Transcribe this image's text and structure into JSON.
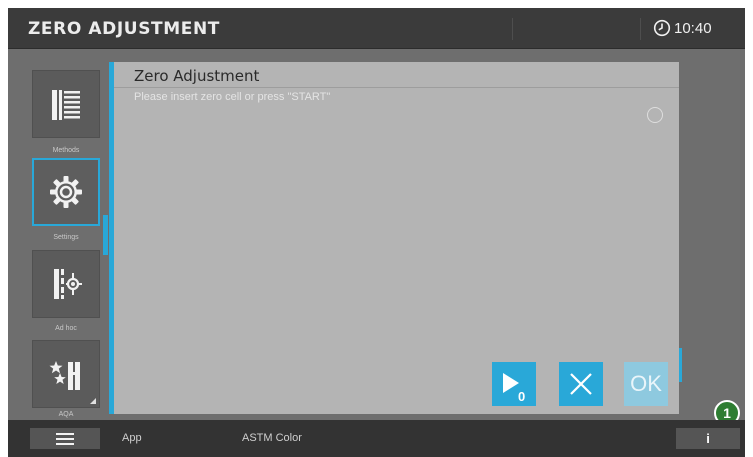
{
  "header": {
    "title": "ZERO ADJUSTMENT",
    "time": "10:40"
  },
  "sidebar": {
    "items": [
      {
        "label": "Methods",
        "icon": "methods-icon"
      },
      {
        "label": "Settings",
        "icon": "gear-icon"
      },
      {
        "label": "Ad hoc",
        "icon": "ad-hoc-icon"
      },
      {
        "label": "AQA",
        "icon": "aqa-icon"
      }
    ],
    "active_index": 1
  },
  "panel": {
    "title": "Zero Adjustment",
    "message": "Please insert zero cell or press \"START\""
  },
  "actions": {
    "start_subscript": "0",
    "ok_label": "OK"
  },
  "annotation": {
    "badge_number": "1"
  },
  "footer": {
    "app_label": "App",
    "method_label": "ASTM Color",
    "info_label": "i"
  },
  "colors": {
    "accent": "#29a8d8",
    "badge": "#2e7d32"
  }
}
